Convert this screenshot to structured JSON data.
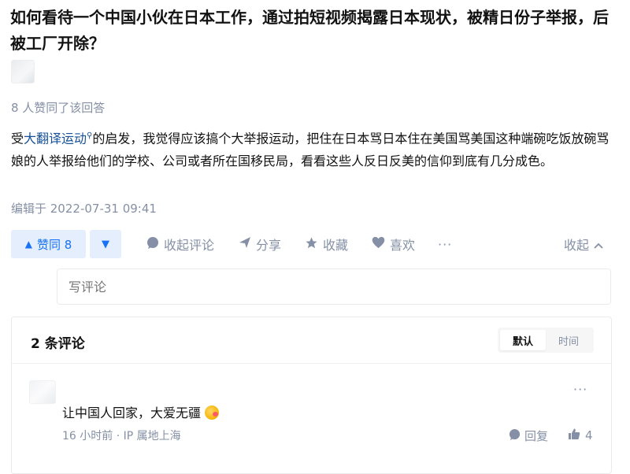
{
  "question": {
    "title": "如何看待一个中国小伙在日本工作，通过拍短视频揭露日本现状，被精日份子举报，后被工厂开除？"
  },
  "answer": {
    "votes_text": "8 人赞同了该回答",
    "text_before": "受",
    "link_text": "大翻译运动",
    "text_after": "的启发，我觉得应该搞个大举报运动，把住在日本骂日本住在美国骂美国这种端碗吃饭放碗骂娘的人举报给他们的学校、公司或者所在国移民局，看看这些人反日反美的信仰到底有几分成色。",
    "edited": "编辑于 2022-07-31 09:41"
  },
  "actions": {
    "vote_up_label": "赞同 8",
    "vote_up_icon": "triangle-up-icon",
    "vote_down_icon": "triangle-down-icon",
    "collapse_comments": "收起评论",
    "share": "分享",
    "favorite": "收藏",
    "like": "喜欢",
    "more": "···",
    "collapse": "收起"
  },
  "comment_input": {
    "placeholder": "写评论"
  },
  "comments": {
    "count_label": "2 条评论",
    "sort_default": "默认",
    "sort_time": "时间",
    "items": [
      {
        "text": "让中国人回家，大爱无疆",
        "meta": "16 小时前 · IP 属地上海",
        "reply": "回复",
        "likes": "4",
        "more": "···"
      }
    ]
  },
  "colors": {
    "accent": "#1772f6",
    "accent_bg": "#e5eefc",
    "muted": "#8590a6",
    "link": "#175199"
  }
}
